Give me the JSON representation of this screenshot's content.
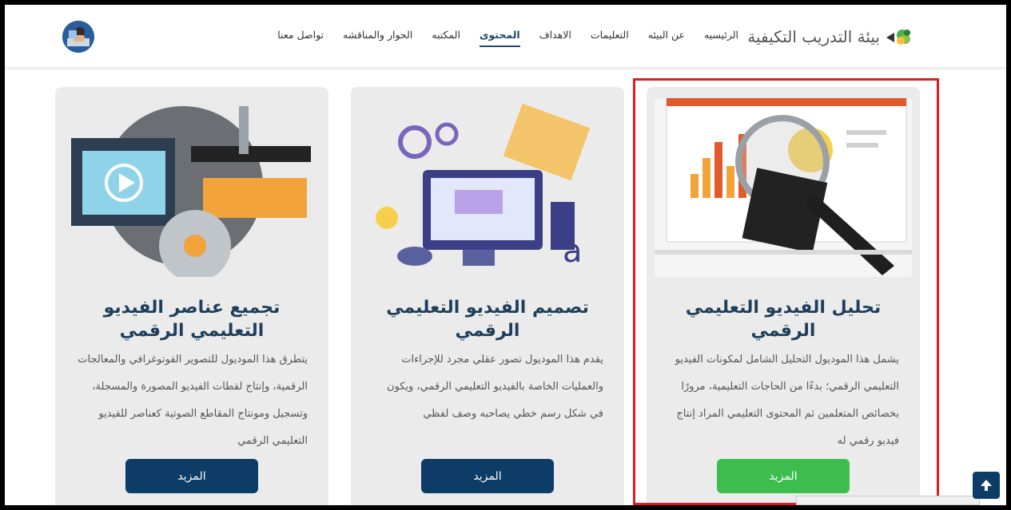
{
  "header": {
    "brand": "بيئة التدريب التكيفية",
    "nav": [
      "الرئيسيه",
      "عن البيئه",
      "التعليمات",
      "الاهداف",
      "المحتوى",
      "المكتبه",
      "الحوار والمناقشه",
      "تواصل معنا"
    ],
    "active_nav": "المحتوى"
  },
  "cards": [
    {
      "title": "تحليل الفيديو التعليمي الرقمي",
      "description": "يشمل هذا الموديول التحليل الشامل لمكونات الفيديو التعليمي الرقمي؛ بدءًا من الحاجات التعليمية، مرورًا بخصائص المتعلمين ثم المحتوى التعليمي المراد إنتاج فيديو رقمي له",
      "button": "المزيد",
      "button_color": "#3dbd4e"
    },
    {
      "title": "تصميم الفيديو التعليمي الرقمي",
      "description": "يقدم هذا الموديول تصور عقلي مجرد للإجراءات والعمليات الخاصة بالفيديو التعليمي الرقمي، ويكون في شكل رسم خطي يصاحبه وصف لفظي",
      "button": "المزيد",
      "button_color": "#0d3c67"
    },
    {
      "title": "تجميع عناصر الفيديو التعليمي الرقمي",
      "description": "يتطرق هذا الموديول للتصوير الفوتوغرافي والمعالجات الرقمية، وإنتاج لقطات الفيديو المصورة والمسجلة، وتسجيل ومونتاج المقاطع الصوتية كعناصر للفيديو التعليمي الرقمي",
      "button": "المزيد",
      "button_color": "#0d3c67"
    }
  ],
  "scroll_top_icon": "arrow-up-icon"
}
